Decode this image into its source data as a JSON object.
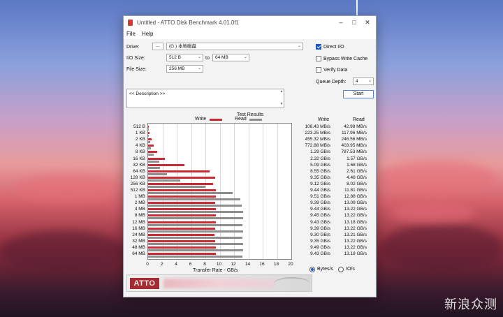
{
  "window": {
    "title": "Untitled - ATTO Disk Benchmark 4.01.0f1"
  },
  "menu": {
    "file": "File",
    "help": "Help"
  },
  "controls": {
    "drive_label": "Drive:",
    "browse_button": "...",
    "drive_value": "(G:) 本地磁盘",
    "io_size_label": "I/O Size:",
    "io_from": "512 B",
    "to_label": "to",
    "io_to": "64 MB",
    "file_size_label": "File Size:",
    "file_size": "256 MB",
    "direct_io": {
      "label": "Direct I/O",
      "checked": true
    },
    "bypass_cache": {
      "label": "Bypass Write Cache",
      "checked": false
    },
    "verify_data": {
      "label": "Verify Data",
      "checked": false
    },
    "queue_depth_label": "Queue Depth:",
    "queue_depth": "4",
    "start_button": "Start",
    "description": "<< Description >>"
  },
  "results": {
    "title": "Test Results",
    "write_legend": "Write",
    "read_legend": "Read",
    "write_header": "Write",
    "read_header": "Read",
    "units_bytes": "Bytes/s",
    "units_io": "IO/s",
    "rows": [
      {
        "size": "512 B",
        "write": "108.43 MB/s",
        "read": "42.98 MB/s"
      },
      {
        "size": "1 KB",
        "write": "223.25 MB/s",
        "read": "117.96 MB/s"
      },
      {
        "size": "2 KB",
        "write": "455.32 MB/s",
        "read": "246.56 MB/s"
      },
      {
        "size": "4 KB",
        "write": "772.88 MB/s",
        "read": "403.95 MB/s"
      },
      {
        "size": "8 KB",
        "write": "1.29 GB/s",
        "read": "787.53 MB/s"
      },
      {
        "size": "16 KB",
        "write": "2.32 GB/s",
        "read": "1.57 GB/s"
      },
      {
        "size": "32 KB",
        "write": "5.09 GB/s",
        "read": "1.68 GB/s"
      },
      {
        "size": "64 KB",
        "write": "8.55 GB/s",
        "read": "2.61 GB/s"
      },
      {
        "size": "128 KB",
        "write": "9.35 GB/s",
        "read": "4.48 GB/s"
      },
      {
        "size": "256 KB",
        "write": "9.12 GB/s",
        "read": "8.02 GB/s"
      },
      {
        "size": "512 KB",
        "write": "9.44 GB/s",
        "read": "11.81 GB/s"
      },
      {
        "size": "1 MB",
        "write": "9.51 GB/s",
        "read": "12.88 GB/s"
      },
      {
        "size": "2 MB",
        "write": "9.39 GB/s",
        "read": "13.09 GB/s"
      },
      {
        "size": "4 MB",
        "write": "9.44 GB/s",
        "read": "13.22 GB/s"
      },
      {
        "size": "8 MB",
        "write": "9.45 GB/s",
        "read": "13.22 GB/s"
      },
      {
        "size": "12 MB",
        "write": "9.43 GB/s",
        "read": "13.18 GB/s"
      },
      {
        "size": "16 MB",
        "write": "9.39 GB/s",
        "read": "13.22 GB/s"
      },
      {
        "size": "24 MB",
        "write": "9.30 GB/s",
        "read": "13.21 GB/s"
      },
      {
        "size": "32 MB",
        "write": "9.35 GB/s",
        "read": "13.22 GB/s"
      },
      {
        "size": "48 MB",
        "write": "9.49 GB/s",
        "read": "13.22 GB/s"
      },
      {
        "size": "64 MB",
        "write": "9.43 GB/s",
        "read": "13.18 GB/s"
      }
    ]
  },
  "chart_data": {
    "type": "bar",
    "orientation": "horizontal",
    "title": "Test Results",
    "xlabel": "Transfer Rate - GB/s",
    "xlim": [
      0,
      20
    ],
    "xticks": [
      0,
      2,
      4,
      6,
      8,
      10,
      12,
      14,
      16,
      18,
      20
    ],
    "categories": [
      "512 B",
      "1 KB",
      "2 KB",
      "4 KB",
      "8 KB",
      "16 KB",
      "32 KB",
      "64 KB",
      "128 KB",
      "256 KB",
      "512 KB",
      "1 MB",
      "2 MB",
      "4 MB",
      "8 MB",
      "12 MB",
      "16 MB",
      "24 MB",
      "32 MB",
      "48 MB",
      "64 MB"
    ],
    "series": [
      {
        "name": "Write",
        "color": "#cc2a34",
        "values": [
          0.108,
          0.223,
          0.455,
          0.773,
          1.29,
          2.32,
          5.09,
          8.55,
          9.35,
          9.12,
          9.44,
          9.51,
          9.39,
          9.44,
          9.45,
          9.43,
          9.39,
          9.3,
          9.35,
          9.49,
          9.43
        ]
      },
      {
        "name": "Read",
        "color": "#8e8e8e",
        "values": [
          0.043,
          0.118,
          0.247,
          0.404,
          0.788,
          1.57,
          1.68,
          2.61,
          4.48,
          8.02,
          11.81,
          12.88,
          13.09,
          13.22,
          13.22,
          13.18,
          13.22,
          13.21,
          13.22,
          13.22,
          13.18
        ]
      }
    ],
    "grid": true,
    "legend": "top"
  },
  "footer": {
    "logo": "ATTO"
  },
  "watermark": "新浪众测"
}
